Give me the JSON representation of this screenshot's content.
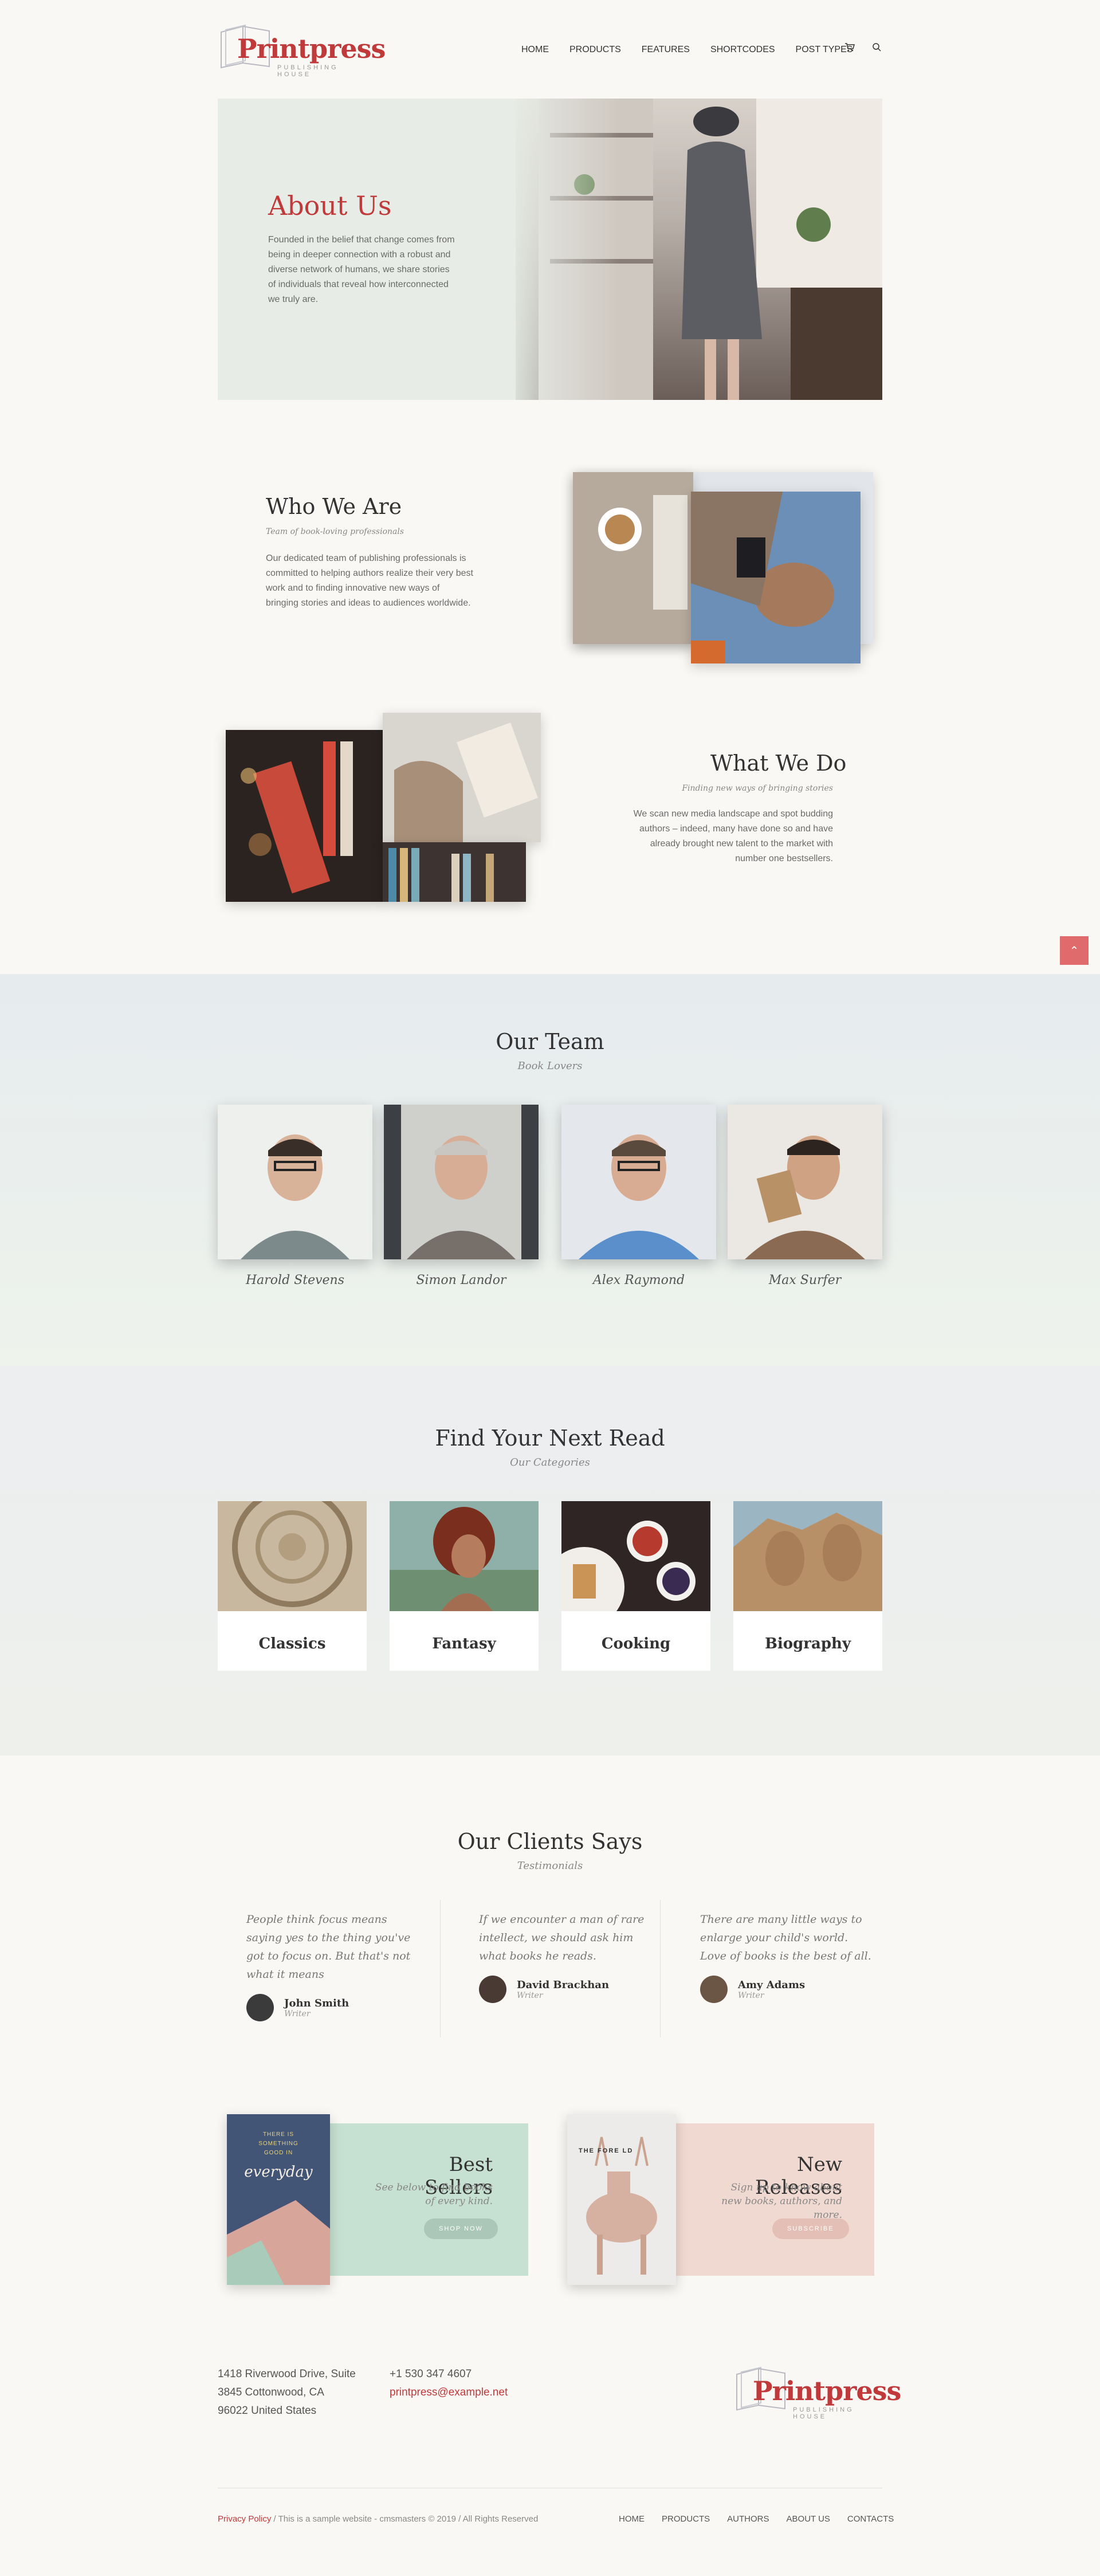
{
  "header": {
    "logo_text": "Printpress",
    "logo_sub": "PUBLISHING HOUSE",
    "nav": [
      "HOME",
      "PRODUCTS",
      "FEATURES",
      "SHORTCODES",
      "POST TYPES"
    ]
  },
  "hero": {
    "title": "About Us",
    "text": "Founded in the belief that change comes from being in deeper connection with a robust and diverse network of humans, we share stories of individuals that reveal how interconnected we truly are."
  },
  "who": {
    "title": "Who We Are",
    "subtitle": "Team of book-loving professionals",
    "text": "Our dedicated team of publishing professionals is committed to helping authors realize their very best work and to finding innovative new ways of bringing stories and ideas to audiences worldwide."
  },
  "what": {
    "title": "What We Do",
    "subtitle": "Finding new ways of bringing stories",
    "text": "We scan new media landscape and spot budding authors – indeed, many have done so and have already brought new talent to the market with number one bestsellers."
  },
  "team": {
    "title": "Our Team",
    "subtitle": "Book Lovers",
    "members": [
      "Harold Stevens",
      "Simon Landor",
      "Alex Raymond",
      "Max Surfer"
    ]
  },
  "categories": {
    "title": "Find Your Next Read",
    "subtitle": "Our Categories",
    "items": [
      "Classics",
      "Fantasy",
      "Cooking",
      "Biography"
    ]
  },
  "testimonials": {
    "title": "Our Clients Says",
    "subtitle": "Testimonials",
    "items": [
      {
        "quote": "People think focus means saying yes to the thing you've got to focus on. But that's not what it means",
        "name": "John Smith",
        "role": "Writer"
      },
      {
        "quote": "If we encounter a man of rare intellect, we should ask him what books he reads.",
        "name": "David Brackhan",
        "role": "Writer"
      },
      {
        "quote": "There are many little ways to enlarge your child's world. Love of books is the best of all.",
        "name": "Amy Adams",
        "role": "Writer"
      }
    ]
  },
  "promos": {
    "best": {
      "title": "Best Sellers",
      "subtitle": "See below to find books of every kind.",
      "button": "SHOP NOW",
      "book_top": "THERE IS SOMETHING GOOD IN",
      "book_script": "everyday"
    },
    "new": {
      "title": "New Releases",
      "subtitle": "Sign up to know about new books, authors, and more.",
      "button": "SUBSCRIBE",
      "book_title": "THE FORE  LD"
    }
  },
  "footer": {
    "address": [
      "1418 Riverwood Drive, Suite",
      "3845 Cottonwood, CA",
      "96022 United States"
    ],
    "phone": "+1 530 347 4607",
    "email": "printpress@example.net",
    "privacy": "Privacy Policy",
    "copyright": " / This is a sample website - cmsmasters © 2019 / All Rights Reserved",
    "nav": [
      "HOME",
      "PRODUCTS",
      "AUTHORS",
      "ABOUT US",
      "CONTACTS"
    ]
  },
  "colors": {
    "accent": "#c0393b",
    "hero_bg": "#e7ede6",
    "mint": "#c6e0d2",
    "blush": "#f0d9d1"
  },
  "icons": [
    "cart-icon",
    "search-icon",
    "arrow-up-icon"
  ]
}
